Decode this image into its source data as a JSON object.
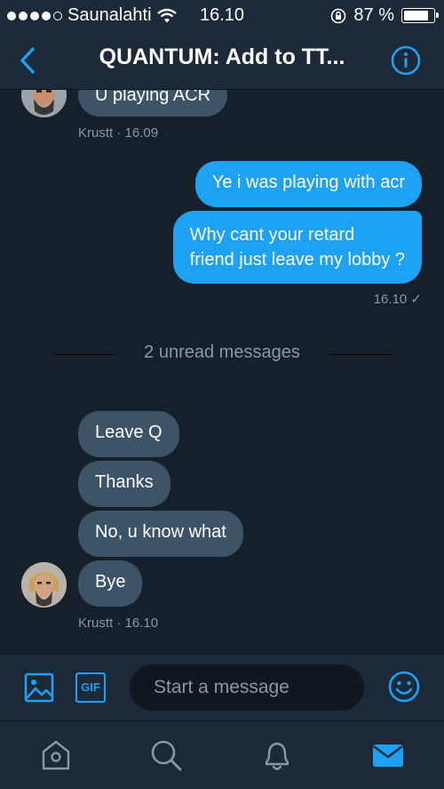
{
  "status_bar": {
    "carrier": "Saunalahti",
    "time": "16.10",
    "battery": "87 %",
    "battery_level": 0.87
  },
  "nav": {
    "title": "QUANTUM: Add to TT..."
  },
  "conversation": {
    "messages": [
      {
        "text": "U playing ACR",
        "direction": "incoming"
      },
      {
        "text": "Ye i was playing with acr",
        "direction": "outgoing"
      },
      {
        "text_lines": [
          "Why cant your retard",
          "friend just leave my lobby ?"
        ],
        "direction": "outgoing"
      },
      {
        "text": "Leave Q",
        "direction": "incoming"
      },
      {
        "text": "Thanks",
        "direction": "incoming"
      },
      {
        "text": "No, u know what",
        "direction": "incoming"
      },
      {
        "text": "Bye",
        "direction": "incoming"
      }
    ],
    "first_meta": "Krustt · 16.09",
    "outgoing_meta": "16.10 ✓",
    "unread_divider": "2 unread messages",
    "last_meta": "Krustt · 16.10"
  },
  "composer": {
    "placeholder": "Start a message",
    "gif_label": "GIF"
  },
  "colors": {
    "background": "#15202b",
    "bar": "#1c2938",
    "accent": "#1da1f2",
    "incoming_bubble": "#3d5466",
    "muted_text": "#8899a6"
  },
  "icons": {
    "back": "chevron-left-icon",
    "info": "info-icon",
    "image": "image-icon",
    "gif": "gif-icon",
    "emoji": "emoji-icon",
    "home": "home-icon",
    "search": "search-icon",
    "notifications": "bell-icon",
    "messages": "envelope-icon"
  }
}
